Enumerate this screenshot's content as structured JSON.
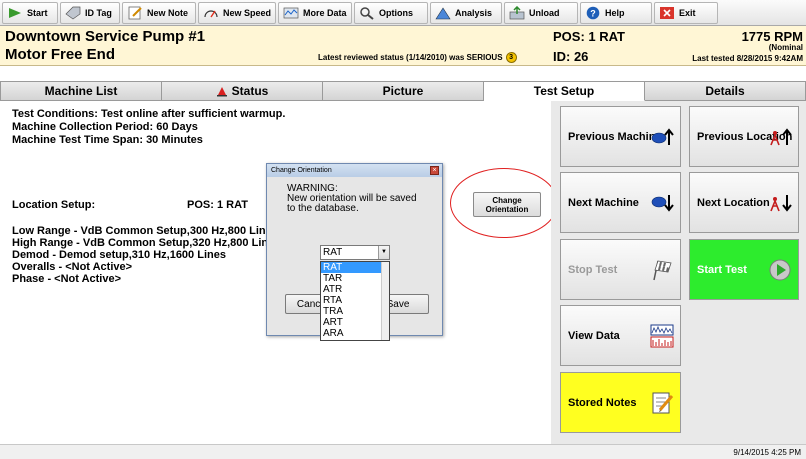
{
  "toolbar": {
    "items": [
      {
        "label": "Start",
        "icon": "start-arrow-icon"
      },
      {
        "label": "ID Tag",
        "icon": "id-tag-icon"
      },
      {
        "label": "New Note",
        "icon": "note-icon"
      },
      {
        "label": "New Speed",
        "icon": "speed-gauge-icon"
      },
      {
        "label": "More Data",
        "icon": "data-icon"
      },
      {
        "label": "Options",
        "icon": "options-icon"
      },
      {
        "label": "Analysis",
        "icon": "analysis-icon"
      },
      {
        "label": "Unload",
        "icon": "unload-icon"
      },
      {
        "label": "Help",
        "icon": "help-icon"
      },
      {
        "label": "Exit",
        "icon": "exit-icon"
      }
    ]
  },
  "header": {
    "machine_name": "Downtown Service Pump #1",
    "subtitle": "Motor Free End",
    "status_text": "Latest reviewed status (1/14/2010) was SERIOUS",
    "pos": "POS: 1  RAT",
    "id": "ID: 26",
    "rpm": "1775 RPM",
    "rpm_note": "(Nominal",
    "last_tested": "Last tested 8/28/2015 9:42AM"
  },
  "tabs": [
    {
      "label": "Machine List",
      "active": false
    },
    {
      "label": "Status",
      "active": false
    },
    {
      "label": "Picture",
      "active": false
    },
    {
      "label": "Test Setup",
      "active": true
    },
    {
      "label": "Details",
      "active": false
    }
  ],
  "test_setup": {
    "conditions": "Test Conditions: Test online after sufficient warmup.",
    "collection_period": "Machine Collection Period: 60 Days",
    "time_span": "Machine Test Time Span: 30 Minutes",
    "location_label": "Location Setup:",
    "location_value": "POS: 1  RAT",
    "change_orientation": "Change Orientation",
    "ranges": [
      "Low Range - VdB Common Setup,300 Hz,800 Lines",
      "High Range - VdB Common Setup,320 Hz,800 Lines",
      "Demod - Demod setup,310 Hz,1600 Lines",
      "Overalls - <Not Active>",
      "Phase - <Not Active>"
    ]
  },
  "right_panel": {
    "previous_machine": "Previous Machine",
    "previous_location": "Previous Location",
    "next_machine": "Next Machine",
    "next_location": "Next Location",
    "stop_test": "Stop Test",
    "start_test": "Start Test",
    "view_data": "View Data",
    "stored_notes": "Stored Notes"
  },
  "dialog": {
    "title": "Change Orientation",
    "warning": "WARNING:",
    "message_line1": "New orientation will be saved",
    "message_line2": "to the database.",
    "selected": "RAT",
    "options": [
      "RAT",
      "TAR",
      "ATR",
      "RTA",
      "TRA",
      "ART",
      "ARA"
    ],
    "cancel": "Cancel",
    "save": "Save"
  },
  "status_bar": {
    "timestamp": "9/14/2015  4:25 PM"
  },
  "colors": {
    "header_bg": "#fff6d5",
    "start_test_bg": "#2dec2d",
    "stored_notes_bg": "#ffff20",
    "selection": "#3399ff",
    "annotation": "#e02020"
  }
}
